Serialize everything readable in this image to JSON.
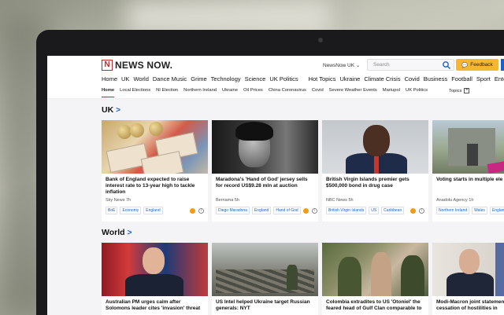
{
  "site": {
    "logo_mark": "N",
    "logo_text": "NEWS NOW.",
    "edition": "NewsNow UK",
    "search_placeholder": "Search",
    "feedback_label": "Feedback"
  },
  "nav_primary": [
    "Home",
    "UK",
    "World",
    "Dance Music",
    "Grime",
    "Technology",
    "Science",
    "UK Politics",
    "Hot Topics",
    "Ukraine",
    "Climate Crisis",
    "Covid",
    "Business",
    "Football",
    "Sport",
    "Entert"
  ],
  "nav_secondary": [
    "Home",
    "Local Elections",
    "NI Election",
    "Northern Ireland",
    "Ukraine",
    "Oil Prices",
    "China Coronavirus",
    "Covid",
    "Severe Weather Events",
    "Mariupol",
    "UK Politics"
  ],
  "nav_secondary_active": "Home",
  "topics_label": "Topics",
  "topics_plus": "+",
  "sections": [
    {
      "title": "UK",
      "chevron": ">",
      "cards": [
        {
          "title": "Bank of England expected to raise interest rate to 13-year high to tackle inflation",
          "source": "Sky News",
          "age": "7h",
          "tags": [
            "BoE",
            "Economy",
            "England"
          ]
        },
        {
          "title": "Maradona's 'Hand of God' jersey sells for record US$9.28 mln at auction",
          "source": "Bernama",
          "age": "5h",
          "tags": [
            "Diego Maradona",
            "England",
            "Hand of God"
          ]
        },
        {
          "title": "British Virgin Islands premier gets $500,000 bond in drug case",
          "source": "NBC News",
          "age": "5h",
          "tags": [
            "British Virgin Islands",
            "US",
            "Caribbean"
          ]
        },
        {
          "title": "Voting starts in multiple ele across UK",
          "source": "Anadolu Agency",
          "age": "1h",
          "tags": [
            "Northern Ireland",
            "Wales",
            "England"
          ]
        }
      ]
    },
    {
      "title": "World",
      "chevron": ">",
      "cards": [
        {
          "title": "Australian PM urges calm after Solomons leader cites 'invasion' threat",
          "source": "",
          "age": "",
          "tags": []
        },
        {
          "title": "US Intel helped Ukraine target Russian generals: NYT",
          "source": "",
          "age": "",
          "tags": []
        },
        {
          "title": "Colombia extradites to US 'Otoniel' the feared head of Gulf Clan comparable to",
          "source": "",
          "age": "",
          "tags": []
        },
        {
          "title": "Modi-Macron joint statement seeks cessation of hostilities in",
          "source": "",
          "age": "",
          "tags": []
        }
      ]
    }
  ],
  "colors": {
    "accent": "#c62828",
    "link": "#1b5fc4",
    "feedback": "#f5b731"
  }
}
